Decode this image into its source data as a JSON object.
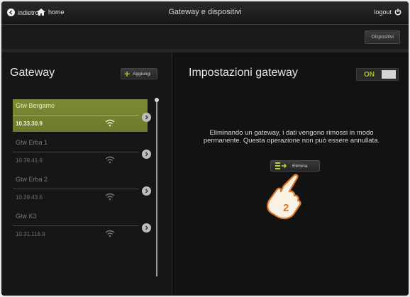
{
  "topbar": {
    "back_label": "indietro",
    "home_label": "home",
    "title": "Gateway e dispositivi",
    "logout_label": "logout"
  },
  "subbar": {
    "devices_label": "Dispositivi"
  },
  "gateway_panel": {
    "title": "Gateway",
    "add_label": "Aggiungi",
    "items": [
      {
        "name": "Gtw Bergamo",
        "ip": "10.33.30.9",
        "selected": true
      },
      {
        "name": "Gtw Erba 1",
        "ip": "10.39.41.6",
        "selected": false
      },
      {
        "name": "Gtw Erba 2",
        "ip": "10.39.43.6",
        "selected": false
      },
      {
        "name": "Gtw K3",
        "ip": "10.31.116.9",
        "selected": false
      }
    ]
  },
  "settings_panel": {
    "title": "Impostazioni gateway",
    "toggle_label": "ON",
    "message": "Eliminando un gateway, i dati vengono rimossi in modo permanente. Questa operazione non può essere annullata.",
    "delete_label": "Elimina",
    "step_badge": "2"
  },
  "colors": {
    "accent": "#9bbf2a",
    "selected_row": "#7d8a35"
  }
}
